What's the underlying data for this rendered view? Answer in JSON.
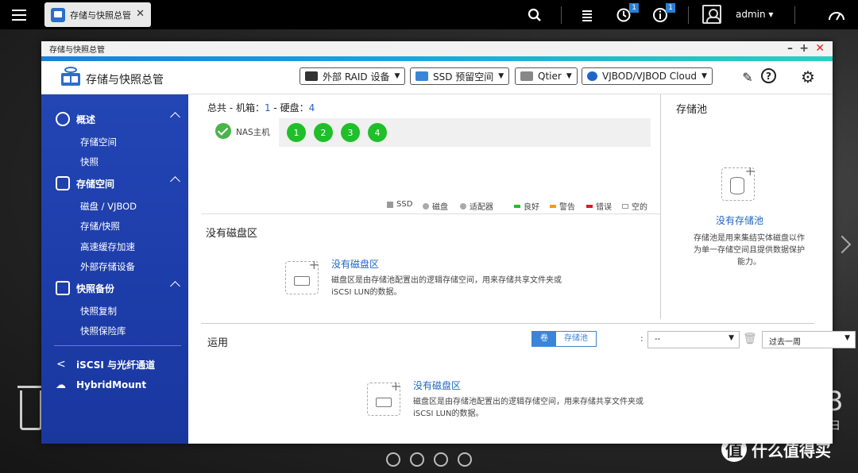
{
  "topbar": {
    "app_tab_label": "存储与快照总管",
    "notif_count_1": "1",
    "notif_count_2": "1",
    "user": "admin ▾"
  },
  "window": {
    "title": "存储与快照总管",
    "app_title": "存储与快照总管",
    "header_buttons": [
      "外部 RAID 设备",
      "SSD 预留空间",
      "Qtier",
      "VJBOD/VJBOD Cloud"
    ]
  },
  "sidebar": {
    "groups": [
      {
        "label": "概述",
        "items": [
          "存储空间",
          "快照"
        ]
      },
      {
        "label": "存储空间",
        "items": [
          "磁盘 / VJBOD",
          "存储/快照",
          "高速缓存加速",
          "外部存储设备"
        ]
      },
      {
        "label": "快照备份",
        "items": [
          "快照复制",
          "快照保险库"
        ]
      }
    ],
    "extra": [
      "iSCSI 与光纤通道",
      "HybridMount"
    ]
  },
  "summary": {
    "prefix": "总共 - 机箱：",
    "chassis": "1",
    "mid": " - 硬盘：",
    "disks": "4"
  },
  "nas": {
    "label": "NAS主机",
    "disks": [
      "1",
      "2",
      "3",
      "4"
    ]
  },
  "legend": [
    {
      "label": "SSD",
      "color": "#999999"
    },
    {
      "label": "磁盘",
      "color": "#aaaaaa"
    },
    {
      "label": "适配器",
      "color": "#aaaaaa"
    },
    {
      "label": "良好",
      "color": "#1fbf2a"
    },
    {
      "label": "警告",
      "color": "#f29a1f"
    },
    {
      "label": "错误",
      "color": "#d32020"
    },
    {
      "label": "空的",
      "color": "#ffffff"
    }
  ],
  "volumes": {
    "title": "没有磁盘区",
    "empty_title": "没有磁盘区",
    "empty_desc_1": "磁盘区是由存储池配置出的逻辑存储空间，用来存储共享文件夹或",
    "empty_desc_2": "iSCSI LUN的数据。"
  },
  "pool": {
    "title": "存储池",
    "empty_title": "没有存储池",
    "desc_1": "存储池是用来集结实体磁盘以作",
    "desc_2": "为单一存储空间且提供数据保护",
    "desc_3": "能力。"
  },
  "usage": {
    "title": "运用",
    "toggle_on": "卷",
    "toggle_off": "存储池",
    "select_value": "--",
    "range_value": "过去一周",
    "empty_title": "没有磁盘区",
    "empty_desc_1": "磁盘区是由存储池配置出的逻辑存储空间，用来存储共享文件夹或",
    "empty_desc_2": "iSCSI LUN的数据。"
  },
  "desktop": {
    "big_digit": "3",
    "big_char": "日",
    "watermark": "什么值得买",
    "watermark_logo": "值"
  },
  "colors": {
    "sidebar": "#1f42b0",
    "accent": "#1f64c9",
    "good": "#1fbf2a"
  }
}
